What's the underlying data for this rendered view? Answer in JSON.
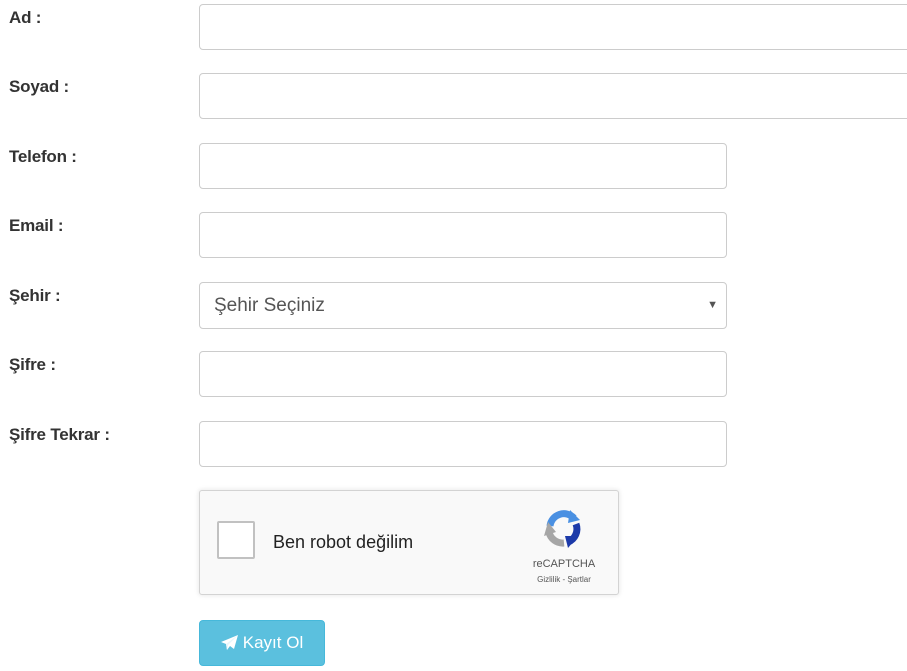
{
  "form": {
    "fields": [
      {
        "label": "Ad :",
        "value": ""
      },
      {
        "label": "Soyad :",
        "value": ""
      },
      {
        "label": "Telefon :",
        "value": ""
      },
      {
        "label": "Email :",
        "value": ""
      },
      {
        "label": "Şehir :",
        "selected": "Şehir Seçiniz"
      },
      {
        "label": "Şifre :",
        "value": ""
      },
      {
        "label": "Şifre Tekrar :",
        "value": ""
      }
    ],
    "captcha": {
      "label": "Ben robot değilim",
      "brand": "reCAPTCHA",
      "links": "Gizlilik - Şartlar",
      "checked": false,
      "icon": "recaptcha-logo-icon"
    },
    "submit": {
      "label": "Kayıt Ol",
      "icon": "paper-plane-icon",
      "color": "#5bc0de"
    }
  }
}
